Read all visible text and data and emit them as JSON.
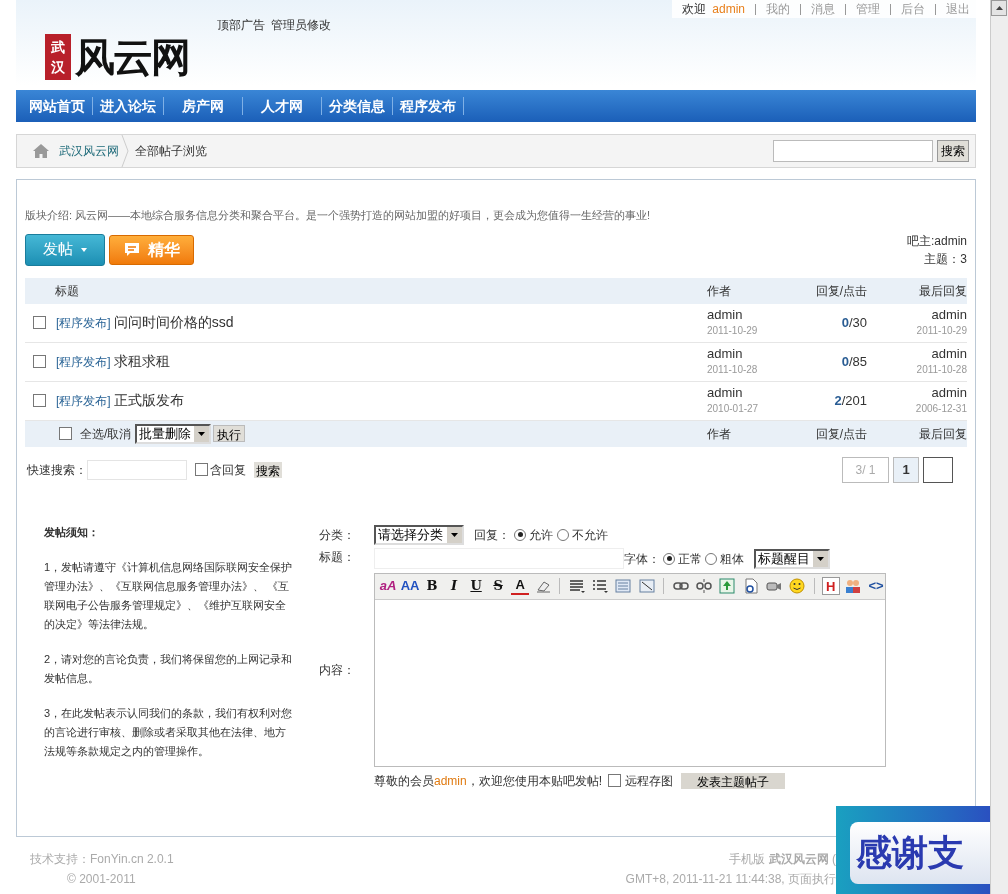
{
  "header": {
    "logo_mark": "武汉",
    "logo_text": "风云网",
    "top_links": [
      "顶部广告",
      "管理员修改"
    ],
    "user_bar": {
      "welcome": "欢迎",
      "user": "admin",
      "links": [
        "我的",
        "消息",
        "管理",
        "后台",
        "退出"
      ]
    }
  },
  "nav": [
    "网站首页",
    "进入论坛",
    "房产网",
    "人才网",
    "分类信息",
    "程序发布"
  ],
  "breadcrumb": {
    "items": [
      "武汉风云网",
      "全部帖子浏览"
    ],
    "search_button": "搜索"
  },
  "forum": {
    "intro": "版块介绍: 风云网——本地综合服务信息分类和聚合平台。是一个强势打造的网站加盟的好项目，更会成为您值得一生经营的事业!",
    "post_button": "发帖",
    "featured_button": "精华",
    "moderator": "吧主:admin",
    "topic_count": "主题：3"
  },
  "table": {
    "columns": [
      "标题",
      "作者",
      "回复/点击",
      "最后回复"
    ],
    "rows": [
      {
        "checked": false,
        "category": "[程序发布]",
        "title": "问问时间价格的ssd",
        "author": "admin",
        "date": "2011-10-29",
        "replies": "0",
        "clicks": "/30",
        "last_user": "admin",
        "last_date": "2011-10-29"
      },
      {
        "checked": false,
        "category": "[程序发布]",
        "title": "求租求租",
        "author": "admin",
        "date": "2011-10-28",
        "replies": "0",
        "clicks": "/85",
        "last_user": "admin",
        "last_date": "2011-10-28"
      },
      {
        "checked": false,
        "category": "[程序发布]",
        "title": "正式版发布",
        "author": "admin",
        "date": "2010-01-27",
        "replies": "2",
        "clicks": "/201",
        "last_user": "admin",
        "last_date": "2006-12-31"
      }
    ],
    "footer": {
      "select_all_checked": false,
      "select_all": "全选/取消",
      "action": "批量删除",
      "execute": "执行",
      "columns": [
        "作者",
        "回复/点击",
        "最后回复"
      ]
    }
  },
  "quick_search": {
    "label": "快速搜索：",
    "include_replies_checked": false,
    "include_replies": "含回复",
    "button": "搜索"
  },
  "pagination": {
    "status": "3/ 1",
    "pages": [
      {
        "label": "1",
        "selected": true
      }
    ]
  },
  "notice": {
    "title": "发帖须知：",
    "items": [
      "1，发帖请遵守《计算机信息网络国际联网安全保护管理办法》、《互联网信息服务管理办法》、 《互联网电子公告服务管理规定》、《维护互联网安全的决定》等法律法规。",
      "2，请对您的言论负责，我们将保留您的上网记录和发帖信息。",
      "3，在此发帖表示认同我们的条款，我们有权利对您的言论进行审核、删除或者采取其他在法律、地方法规等条款规定之内的管理操作。"
    ]
  },
  "form": {
    "category_label": "分类：",
    "category": "请选择分类",
    "reply_label": "回复：",
    "reply_options": [
      {
        "label": "允许",
        "selected": true
      },
      {
        "label": "不允许",
        "selected": false
      }
    ],
    "title_label": "标题：",
    "font_label": "字体：",
    "font_options": [
      {
        "label": "正常",
        "selected": true
      },
      {
        "label": "粗体",
        "selected": false
      }
    ],
    "highlight": "标题醒目",
    "toolbar": [
      {
        "kind": "fontname",
        "label": "aA"
      },
      {
        "kind": "fontsize",
        "label": "AA"
      },
      {
        "kind": "bold",
        "label": "B"
      },
      {
        "kind": "italic",
        "label": "I"
      },
      {
        "kind": "underline",
        "label": "U"
      },
      {
        "kind": "strike",
        "label": "S"
      },
      {
        "kind": "color",
        "label": "A"
      },
      {
        "kind": "eraser"
      },
      {
        "kind": "separator"
      },
      {
        "kind": "align"
      },
      {
        "kind": "list"
      },
      {
        "kind": "table"
      },
      {
        "kind": "frame"
      },
      {
        "kind": "separator"
      },
      {
        "kind": "link"
      },
      {
        "kind": "unlink"
      },
      {
        "kind": "image"
      },
      {
        "kind": "flash"
      },
      {
        "kind": "media"
      },
      {
        "kind": "smiley"
      },
      {
        "kind": "separator"
      },
      {
        "kind": "boxed",
        "label": "H"
      },
      {
        "kind": "people"
      },
      {
        "kind": "code",
        "label": "<>"
      }
    ],
    "content_label": "内容：",
    "member_prefix": "尊敬的会员",
    "member": "admin",
    "member_suffix": "，欢迎您使用本贴吧发帖!",
    "remote_checked": false,
    "remote_label": "远程存图",
    "submit": "发表主题帖子"
  },
  "footer": {
    "support": "技术支持：FonYin.cn 2.0.1",
    "copyright": "© 2001-2011",
    "mobile": "手机版 **武汉风云网** (",
    "time": "GMT+8, 2011-11-21 11:44:38, 页面执行"
  },
  "banner": {
    "text": "感谢支"
  }
}
